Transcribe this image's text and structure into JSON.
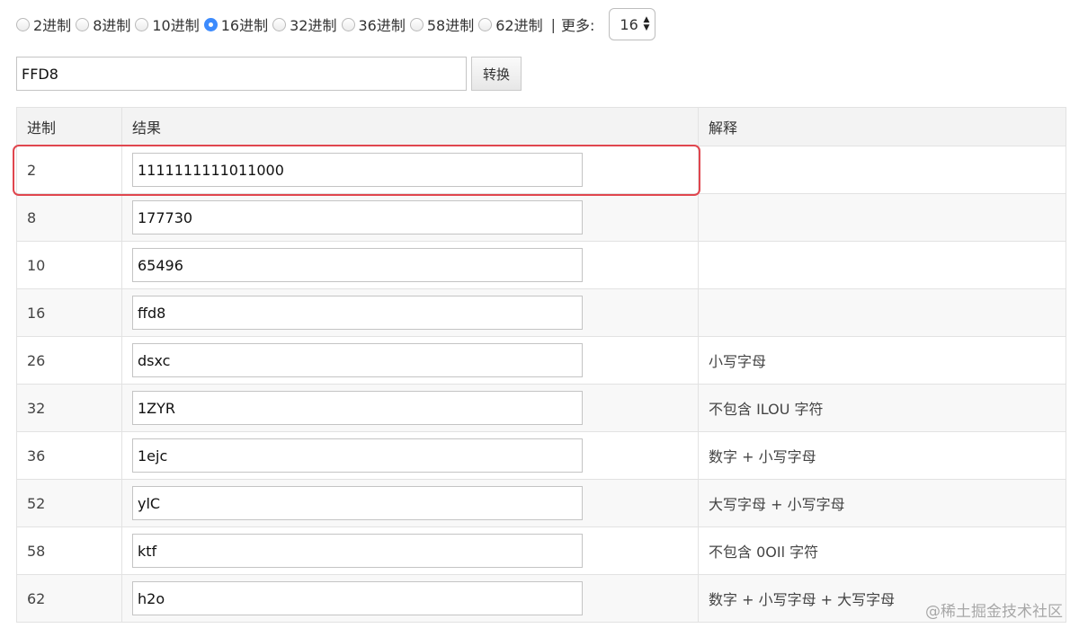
{
  "radix_options": [
    {
      "label": "2进制",
      "checked": false
    },
    {
      "label": "8进制",
      "checked": false
    },
    {
      "label": "10进制",
      "checked": false
    },
    {
      "label": "16进制",
      "checked": true
    },
    {
      "label": "32进制",
      "checked": false
    },
    {
      "label": "36进制",
      "checked": false
    },
    {
      "label": "58进制",
      "checked": false
    },
    {
      "label": "62进制",
      "checked": false
    }
  ],
  "more": {
    "separator": "|",
    "label": "更多:",
    "selected": "16"
  },
  "input": {
    "value": "FFD8",
    "button_label": "转换"
  },
  "table": {
    "headers": [
      "进制",
      "结果",
      "解释"
    ],
    "rows": [
      {
        "base": "2",
        "result": "1111111111011000",
        "explain": ""
      },
      {
        "base": "8",
        "result": "177730",
        "explain": ""
      },
      {
        "base": "10",
        "result": "65496",
        "explain": ""
      },
      {
        "base": "16",
        "result": "ffd8",
        "explain": ""
      },
      {
        "base": "26",
        "result": "dsxc",
        "explain": "小写字母"
      },
      {
        "base": "32",
        "result": "1ZYR",
        "explain": "不包含 ILOU 字符"
      },
      {
        "base": "36",
        "result": "1ejc",
        "explain": "数字 + 小写字母"
      },
      {
        "base": "52",
        "result": "ylC",
        "explain": "大写字母 + 小写字母"
      },
      {
        "base": "58",
        "result": "ktf",
        "explain": "不包含 0OIl 字符"
      },
      {
        "base": "62",
        "result": "h2o",
        "explain": "数字 + 小写字母 + 大写字母"
      }
    ]
  },
  "watermark": "@稀土掘金技术社区",
  "colors": {
    "accent": "#3d8bfd",
    "highlight": "#e0464e"
  }
}
